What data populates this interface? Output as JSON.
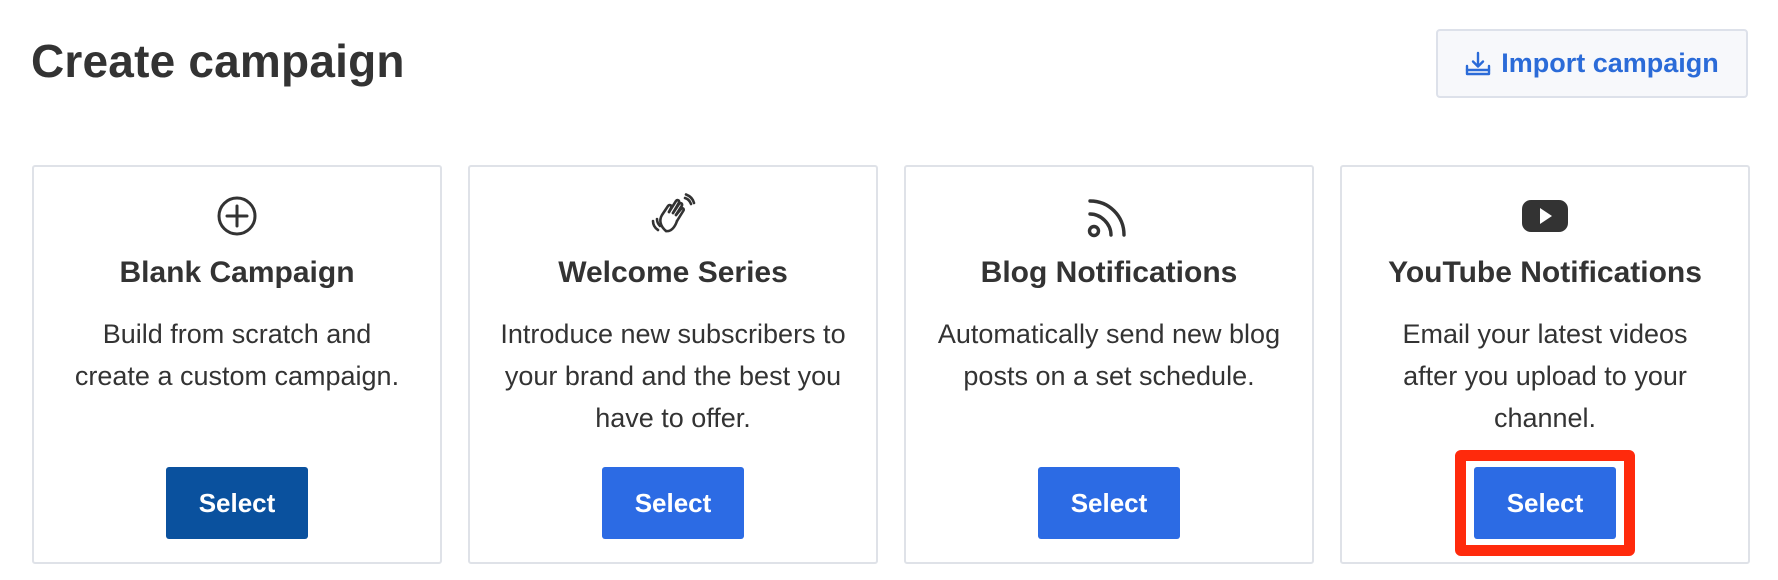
{
  "header": {
    "title": "Create campaign",
    "import_label": "Import campaign",
    "import_icon": "download-tray-icon",
    "accent_color": "#2b6bd8"
  },
  "cards": [
    {
      "icon": "plus-circle-icon",
      "title": "Blank Campaign",
      "description": "Build from scratch and create a custom campaign.",
      "button_label": "Select",
      "button_color": "#0a519e"
    },
    {
      "icon": "waving-hand-icon",
      "title": "Welcome Series",
      "description": "Introduce new subscribers to your brand and the best you have to offer.",
      "button_label": "Select",
      "button_color": "#2c6be4"
    },
    {
      "icon": "rss-feed-icon",
      "title": "Blog Notifications",
      "description": "Automatically send new blog posts on a set schedule.",
      "button_label": "Select",
      "button_color": "#2c6be4"
    },
    {
      "icon": "youtube-play-icon",
      "title": "YouTube Notifications",
      "description": "Email your latest videos after you upload to your channel.",
      "button_label": "Select",
      "button_color": "#2c6be4",
      "highlighted": true,
      "highlight_color": "#ff2a0c"
    }
  ]
}
